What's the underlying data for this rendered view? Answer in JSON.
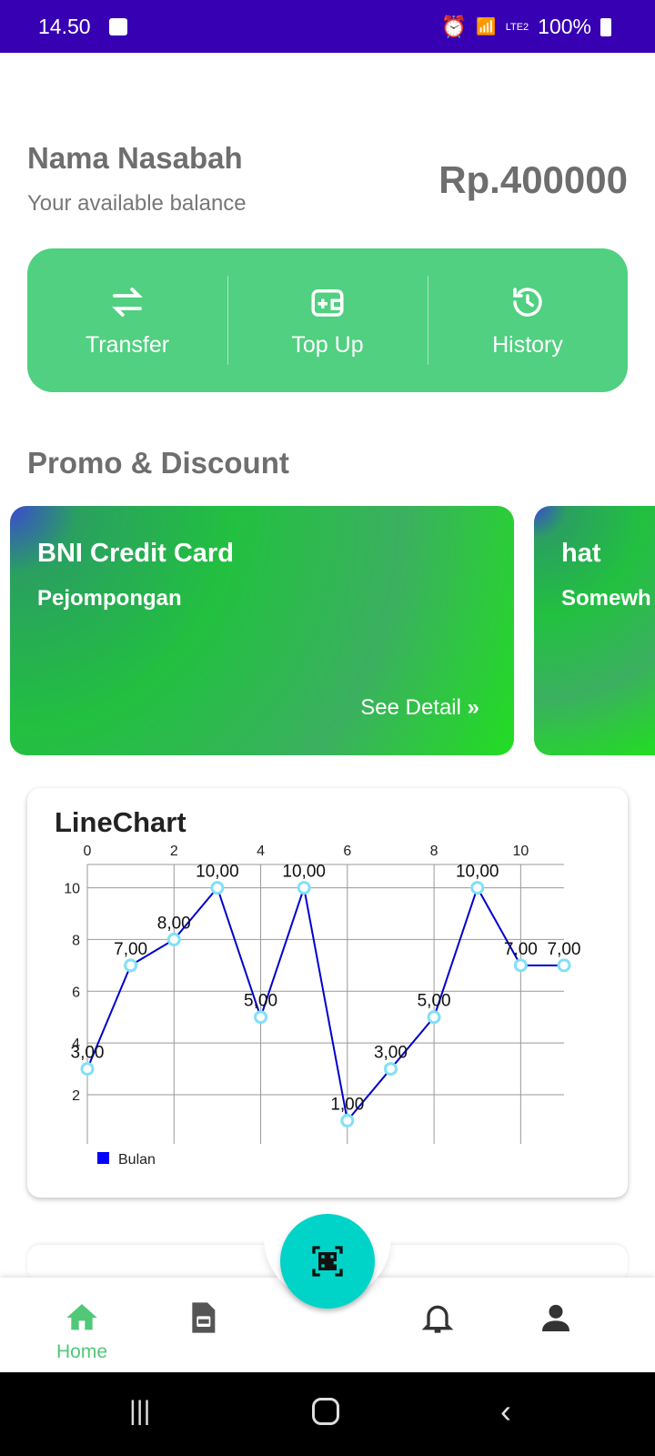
{
  "status_bar": {
    "time": "14.50",
    "battery": "100%",
    "network": "LTE2"
  },
  "header": {
    "customer_name": "Nama Nasabah",
    "balance_label": "Your available balance",
    "balance": "Rp.400000"
  },
  "actions": [
    {
      "label": "Transfer",
      "icon": "transfer-icon"
    },
    {
      "label": "Top Up",
      "icon": "wallet-add-icon"
    },
    {
      "label": "History",
      "icon": "history-icon"
    }
  ],
  "promo": {
    "title": "Promo & Discount",
    "cards": [
      {
        "title": "BNI Credit Card",
        "subtitle": "Pejompongan",
        "cta": "See Detail"
      },
      {
        "title": "hat",
        "subtitle": "Somewh"
      }
    ]
  },
  "chart_data": {
    "type": "line",
    "title": "LineChart",
    "x": [
      0,
      1,
      2,
      3,
      4,
      5,
      6,
      7,
      8,
      9,
      10,
      11
    ],
    "series": [
      {
        "name": "Bulan",
        "values": [
          3,
          7,
          8,
          10,
          5,
          10,
          1,
          3,
          5,
          10,
          7,
          7
        ],
        "color": "#0000cc"
      }
    ],
    "value_labels": [
      "3,00",
      "7,00",
      "8,00",
      "10,00",
      "5,00",
      "10,00",
      "1,00",
      "3,00",
      "5,00",
      "10,00",
      "7,00",
      "7,00"
    ],
    "x_ticks": [
      "0",
      "2",
      "4",
      "6",
      "8",
      "10"
    ],
    "y_ticks": [
      "2",
      "4",
      "6",
      "8",
      "10"
    ],
    "xlim": [
      0,
      11
    ],
    "ylim": [
      0.1,
      10.9
    ],
    "grid": true,
    "legend": "bottom-left"
  },
  "nav": {
    "items": [
      {
        "label": "Home",
        "active": true
      },
      {
        "label": "Documents"
      },
      {
        "label": "Notifications"
      },
      {
        "label": "Profile"
      }
    ],
    "accent": "#50c878"
  }
}
